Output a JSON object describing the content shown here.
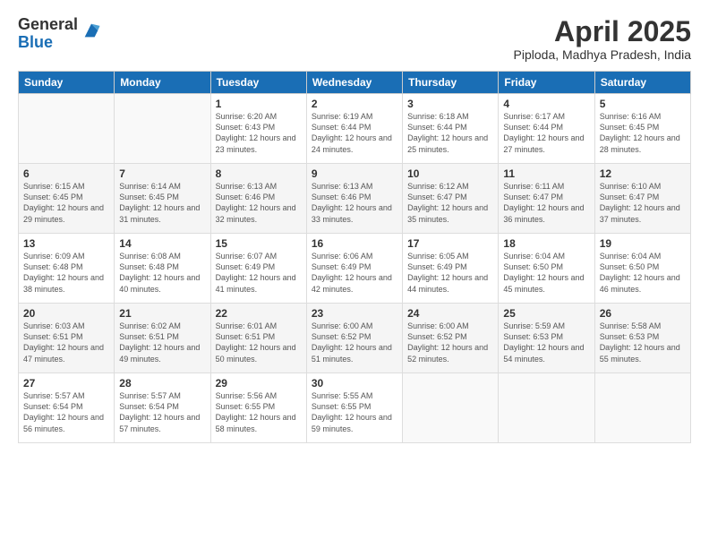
{
  "logo": {
    "general": "General",
    "blue": "Blue"
  },
  "header": {
    "month": "April 2025",
    "location": "Piploda, Madhya Pradesh, India"
  },
  "days_of_week": [
    "Sunday",
    "Monday",
    "Tuesday",
    "Wednesday",
    "Thursday",
    "Friday",
    "Saturday"
  ],
  "weeks": [
    [
      {
        "day": "",
        "sunrise": "",
        "sunset": "",
        "daylight": ""
      },
      {
        "day": "",
        "sunrise": "",
        "sunset": "",
        "daylight": ""
      },
      {
        "day": "1",
        "sunrise": "Sunrise: 6:20 AM",
        "sunset": "Sunset: 6:43 PM",
        "daylight": "Daylight: 12 hours and 23 minutes."
      },
      {
        "day": "2",
        "sunrise": "Sunrise: 6:19 AM",
        "sunset": "Sunset: 6:44 PM",
        "daylight": "Daylight: 12 hours and 24 minutes."
      },
      {
        "day": "3",
        "sunrise": "Sunrise: 6:18 AM",
        "sunset": "Sunset: 6:44 PM",
        "daylight": "Daylight: 12 hours and 25 minutes."
      },
      {
        "day": "4",
        "sunrise": "Sunrise: 6:17 AM",
        "sunset": "Sunset: 6:44 PM",
        "daylight": "Daylight: 12 hours and 27 minutes."
      },
      {
        "day": "5",
        "sunrise": "Sunrise: 6:16 AM",
        "sunset": "Sunset: 6:45 PM",
        "daylight": "Daylight: 12 hours and 28 minutes."
      }
    ],
    [
      {
        "day": "6",
        "sunrise": "Sunrise: 6:15 AM",
        "sunset": "Sunset: 6:45 PM",
        "daylight": "Daylight: 12 hours and 29 minutes."
      },
      {
        "day": "7",
        "sunrise": "Sunrise: 6:14 AM",
        "sunset": "Sunset: 6:45 PM",
        "daylight": "Daylight: 12 hours and 31 minutes."
      },
      {
        "day": "8",
        "sunrise": "Sunrise: 6:13 AM",
        "sunset": "Sunset: 6:46 PM",
        "daylight": "Daylight: 12 hours and 32 minutes."
      },
      {
        "day": "9",
        "sunrise": "Sunrise: 6:13 AM",
        "sunset": "Sunset: 6:46 PM",
        "daylight": "Daylight: 12 hours and 33 minutes."
      },
      {
        "day": "10",
        "sunrise": "Sunrise: 6:12 AM",
        "sunset": "Sunset: 6:47 PM",
        "daylight": "Daylight: 12 hours and 35 minutes."
      },
      {
        "day": "11",
        "sunrise": "Sunrise: 6:11 AM",
        "sunset": "Sunset: 6:47 PM",
        "daylight": "Daylight: 12 hours and 36 minutes."
      },
      {
        "day": "12",
        "sunrise": "Sunrise: 6:10 AM",
        "sunset": "Sunset: 6:47 PM",
        "daylight": "Daylight: 12 hours and 37 minutes."
      }
    ],
    [
      {
        "day": "13",
        "sunrise": "Sunrise: 6:09 AM",
        "sunset": "Sunset: 6:48 PM",
        "daylight": "Daylight: 12 hours and 38 minutes."
      },
      {
        "day": "14",
        "sunrise": "Sunrise: 6:08 AM",
        "sunset": "Sunset: 6:48 PM",
        "daylight": "Daylight: 12 hours and 40 minutes."
      },
      {
        "day": "15",
        "sunrise": "Sunrise: 6:07 AM",
        "sunset": "Sunset: 6:49 PM",
        "daylight": "Daylight: 12 hours and 41 minutes."
      },
      {
        "day": "16",
        "sunrise": "Sunrise: 6:06 AM",
        "sunset": "Sunset: 6:49 PM",
        "daylight": "Daylight: 12 hours and 42 minutes."
      },
      {
        "day": "17",
        "sunrise": "Sunrise: 6:05 AM",
        "sunset": "Sunset: 6:49 PM",
        "daylight": "Daylight: 12 hours and 44 minutes."
      },
      {
        "day": "18",
        "sunrise": "Sunrise: 6:04 AM",
        "sunset": "Sunset: 6:50 PM",
        "daylight": "Daylight: 12 hours and 45 minutes."
      },
      {
        "day": "19",
        "sunrise": "Sunrise: 6:04 AM",
        "sunset": "Sunset: 6:50 PM",
        "daylight": "Daylight: 12 hours and 46 minutes."
      }
    ],
    [
      {
        "day": "20",
        "sunrise": "Sunrise: 6:03 AM",
        "sunset": "Sunset: 6:51 PM",
        "daylight": "Daylight: 12 hours and 47 minutes."
      },
      {
        "day": "21",
        "sunrise": "Sunrise: 6:02 AM",
        "sunset": "Sunset: 6:51 PM",
        "daylight": "Daylight: 12 hours and 49 minutes."
      },
      {
        "day": "22",
        "sunrise": "Sunrise: 6:01 AM",
        "sunset": "Sunset: 6:51 PM",
        "daylight": "Daylight: 12 hours and 50 minutes."
      },
      {
        "day": "23",
        "sunrise": "Sunrise: 6:00 AM",
        "sunset": "Sunset: 6:52 PM",
        "daylight": "Daylight: 12 hours and 51 minutes."
      },
      {
        "day": "24",
        "sunrise": "Sunrise: 6:00 AM",
        "sunset": "Sunset: 6:52 PM",
        "daylight": "Daylight: 12 hours and 52 minutes."
      },
      {
        "day": "25",
        "sunrise": "Sunrise: 5:59 AM",
        "sunset": "Sunset: 6:53 PM",
        "daylight": "Daylight: 12 hours and 54 minutes."
      },
      {
        "day": "26",
        "sunrise": "Sunrise: 5:58 AM",
        "sunset": "Sunset: 6:53 PM",
        "daylight": "Daylight: 12 hours and 55 minutes."
      }
    ],
    [
      {
        "day": "27",
        "sunrise": "Sunrise: 5:57 AM",
        "sunset": "Sunset: 6:54 PM",
        "daylight": "Daylight: 12 hours and 56 minutes."
      },
      {
        "day": "28",
        "sunrise": "Sunrise: 5:57 AM",
        "sunset": "Sunset: 6:54 PM",
        "daylight": "Daylight: 12 hours and 57 minutes."
      },
      {
        "day": "29",
        "sunrise": "Sunrise: 5:56 AM",
        "sunset": "Sunset: 6:55 PM",
        "daylight": "Daylight: 12 hours and 58 minutes."
      },
      {
        "day": "30",
        "sunrise": "Sunrise: 5:55 AM",
        "sunset": "Sunset: 6:55 PM",
        "daylight": "Daylight: 12 hours and 59 minutes."
      },
      {
        "day": "",
        "sunrise": "",
        "sunset": "",
        "daylight": ""
      },
      {
        "day": "",
        "sunrise": "",
        "sunset": "",
        "daylight": ""
      },
      {
        "day": "",
        "sunrise": "",
        "sunset": "",
        "daylight": ""
      }
    ]
  ]
}
